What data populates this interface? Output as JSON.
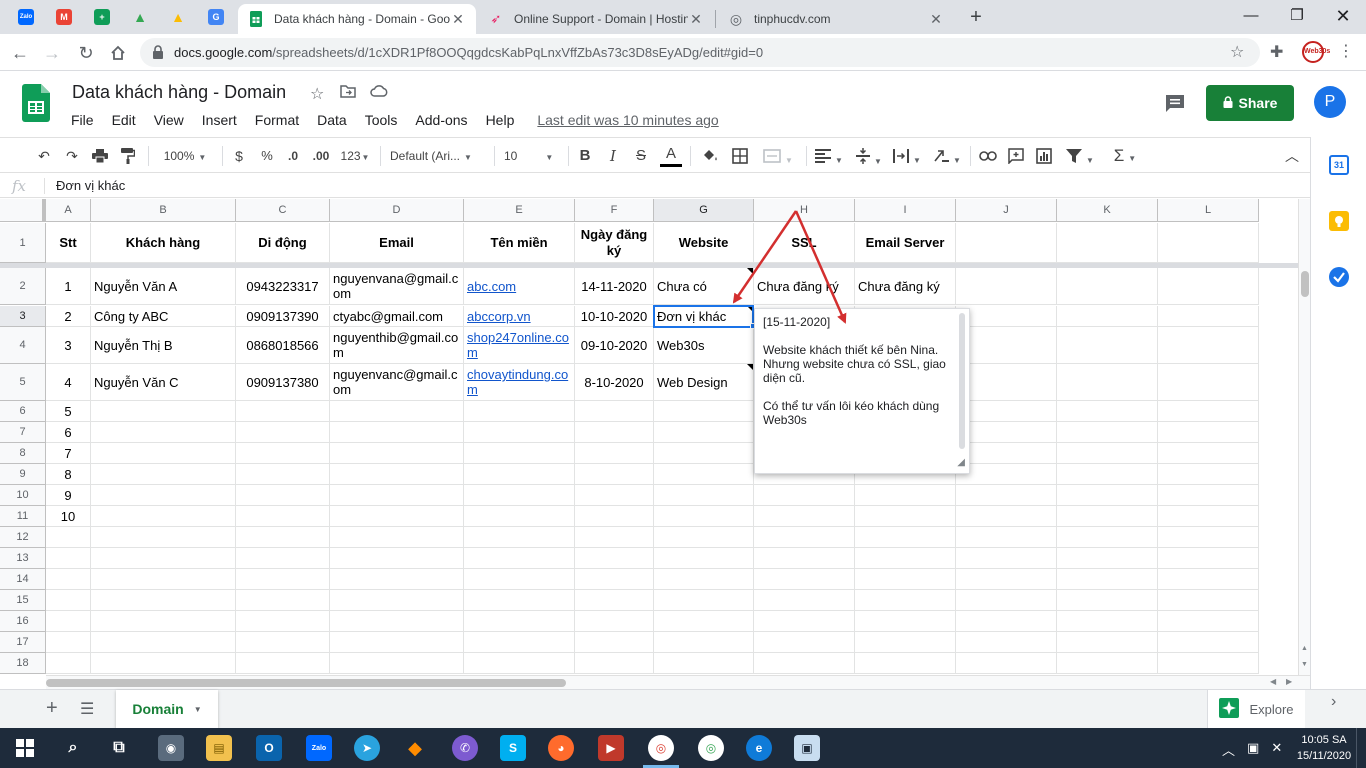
{
  "browser": {
    "pinned_tabs": [
      {
        "name": "zalo-tab",
        "label": "Zalo",
        "color": "#0068ff"
      },
      {
        "name": "gmail-tab",
        "label": "M",
        "color": "#ea4335"
      },
      {
        "name": "sheets-tab-pinned",
        "label": "+",
        "color": "#0f9d58"
      },
      {
        "name": "drive-tab-1",
        "label": "▲",
        "color": "#34a853"
      },
      {
        "name": "drive-tab-2",
        "label": "▲",
        "color": "#fbbc04"
      },
      {
        "name": "translate-tab",
        "label": "G",
        "color": "#4285f4"
      }
    ],
    "tabs": [
      {
        "title": "Data khách hàng - Domain - Goo",
        "active": true
      },
      {
        "title": "Online Support - Domain | Hostin",
        "active": false
      },
      {
        "title": "tinphucdv.com",
        "active": false
      }
    ],
    "url_main": "docs.google.com",
    "url_rest": "/spreadsheets/d/1cXDR1Pf8OOQqgdcsKabPqLnxVffZbAs73c3D8sEyADg/edit#gid=0",
    "profile_badge": "Web30s"
  },
  "doc": {
    "title": "Data khách hàng - Domain",
    "menus": [
      "File",
      "Edit",
      "View",
      "Insert",
      "Format",
      "Data",
      "Tools",
      "Add-ons",
      "Help"
    ],
    "last_edit": "Last edit was 10 minutes ago",
    "share_label": "Share",
    "avatar_letter": "P"
  },
  "toolbar": {
    "zoom": "100%",
    "currency": "$",
    "percent": "%",
    "dec_less": ".0",
    "dec_more": ".00",
    "format_more": "123",
    "font": "Default (Ari...",
    "font_size": "10"
  },
  "formula_bar": {
    "fx": "fx",
    "value": "Đơn vị khác"
  },
  "grid": {
    "columns": [
      "A",
      "B",
      "C",
      "D",
      "E",
      "F",
      "G",
      "H",
      "I",
      "J",
      "K",
      "L"
    ],
    "selected_column": "G",
    "selected_row": "3",
    "rows": [
      "1",
      "2",
      "3",
      "4",
      "5",
      "6",
      "7",
      "8",
      "9",
      "10",
      "11",
      "12",
      "13",
      "14",
      "15",
      "16",
      "17",
      "18"
    ],
    "headers": [
      "Stt",
      "Khách hàng",
      "Di động",
      "Email",
      "Tên miền",
      "Ngày đăng ký",
      "Website",
      "SSL",
      "Email Server"
    ],
    "records": [
      [
        "1",
        "Nguyễn Văn A",
        "0943223317",
        "nguyenvana@gmail.com",
        "abc.com",
        "14-11-2020",
        "Chưa có",
        "Chưa đăng ký",
        "Chưa đăng ký"
      ],
      [
        "2",
        "Công ty ABC",
        "0909137390",
        "ctyabc@gmail.com",
        "abccorp.vn",
        "10-10-2020",
        "Đơn vị khác",
        "",
        ""
      ],
      [
        "3",
        "Nguyễn Thị B",
        "0868018566",
        "nguyenthib@gmail.com",
        "shop247online.com",
        "09-10-2020",
        "Web30s",
        "",
        ""
      ],
      [
        "4",
        "Nguyễn Văn C",
        "0909137380",
        "nguyenvanc@gmail.com",
        "chovaytindung.com",
        "8-10-2020",
        "Web Design",
        "",
        ""
      ]
    ],
    "stt_extra": [
      "5",
      "6",
      "7",
      "8",
      "9",
      "10"
    ]
  },
  "note": {
    "date": "[15-11-2020]",
    "para1": "Website khách thiết kế bên Nina. Nhưng website chưa có SSL, giao diện cũ.",
    "para2": "Có thể tư vấn lôi kéo khách dùng Web30s"
  },
  "sheetbar": {
    "sheet_name": "Domain",
    "explore_label": "Explore"
  },
  "taskbar": {
    "time": "10:05 SA",
    "date": "15/11/2020"
  },
  "colors": {
    "sheets_green": "#188038",
    "selection_blue": "#1a73e8",
    "link_blue": "#1155cc",
    "arrow_red": "#d32f2f"
  }
}
